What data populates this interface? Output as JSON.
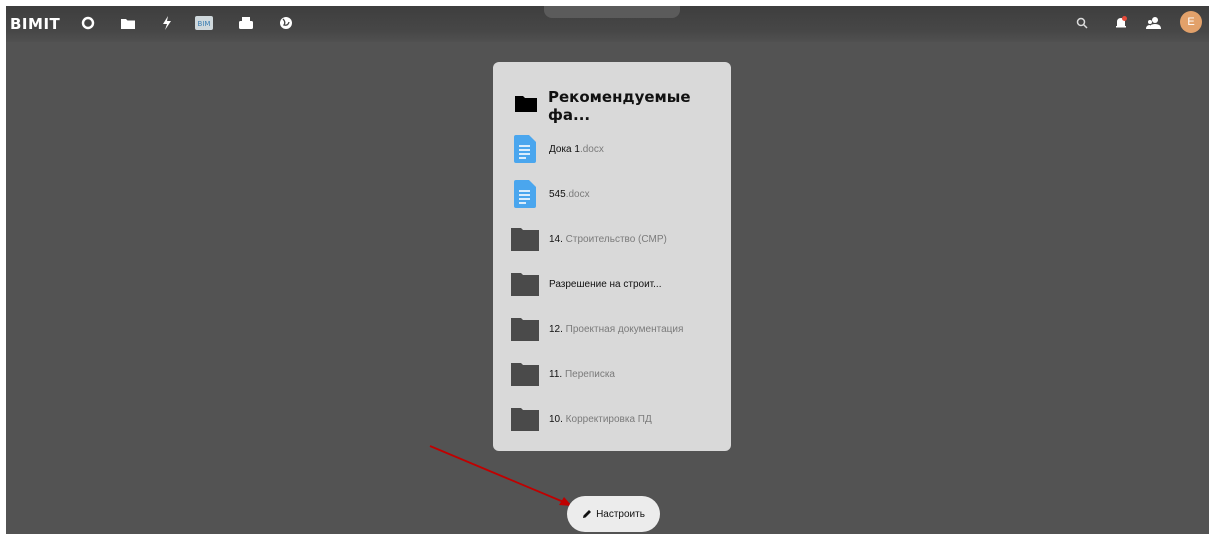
{
  "topbar": {
    "logo": "BIMIT",
    "nav_icons": [
      "circle-icon",
      "folder-icon",
      "lightning-icon",
      "bim-icon",
      "printer-icon",
      "globe-icon"
    ],
    "bim_badge": "BIM",
    "right_icons": [
      "search-icon",
      "bell-icon",
      "users-icon"
    ],
    "avatar_letter": "E"
  },
  "card": {
    "title": "Рекомендуемые фа...",
    "items": [
      {
        "type": "doc",
        "name": "Дока 1",
        "ext": ".docx"
      },
      {
        "type": "doc",
        "name": "545",
        "ext": ".docx"
      },
      {
        "type": "folder",
        "prefix": "14.",
        "name": " Строительство (СМР)"
      },
      {
        "type": "folder",
        "prefix": "",
        "name": "Разрешение на строит..."
      },
      {
        "type": "folder",
        "prefix": "12.",
        "name": " Проектная документация"
      },
      {
        "type": "folder",
        "prefix": "11.",
        "name": " Переписка"
      },
      {
        "type": "folder",
        "prefix": "10.",
        "name": " Корректировка ПД"
      }
    ]
  },
  "configure_button": {
    "label": "Настроить"
  },
  "colors": {
    "background": "#535353",
    "card": "#d9d9d9",
    "doc_icon": "#4aa6ee",
    "folder_icon": "#4a4a4a",
    "arrow": "#c00000",
    "avatar": "#e2a16a"
  }
}
